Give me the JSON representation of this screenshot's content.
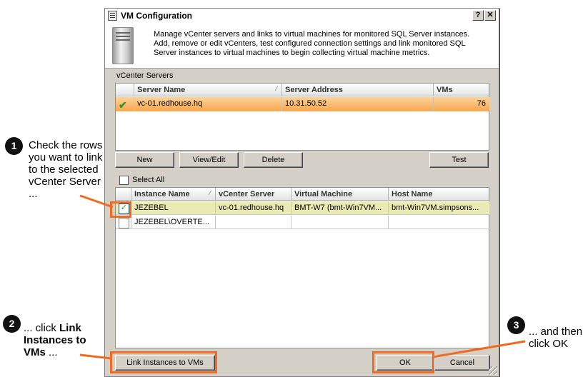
{
  "dialog": {
    "title": "VM Configuration",
    "help_button": "?",
    "close_button": "✕",
    "description": "Manage vCenter servers and links to virtual machines for monitored SQL Server instances. Add, remove or edit vCenters, test configured connection settings and link monitored SQL Server instances to virtual machines to begin collecting virtual machine metrics."
  },
  "vcenter": {
    "section_label": "vCenter Servers",
    "columns": [
      "Server Name",
      "Server Address",
      "VMs"
    ],
    "rows": [
      {
        "name": "vc-01.redhouse.hq",
        "address": "10.31.50.52",
        "vms": "76"
      }
    ],
    "buttons": {
      "new": "New",
      "view_edit": "View/Edit",
      "delete": "Delete",
      "test": "Test"
    }
  },
  "instances": {
    "select_all": "Select All",
    "columns": [
      "Instance Name",
      "vCenter Server",
      "Virtual Machine",
      "Host Name"
    ],
    "rows": [
      {
        "instance": "JEZEBEL",
        "vcenter": "vc-01.redhouse.hq",
        "vm": "BMT-W7  (bmt-Win7VM...",
        "host": "bmt-Win7VM.simpsons...",
        "checked": true
      },
      {
        "instance": "JEZEBEL\\OVERTE...",
        "vcenter": "",
        "vm": "",
        "host": "",
        "checked": false
      }
    ]
  },
  "footer": {
    "link_button": "Link Instances to VMs",
    "ok": "OK",
    "cancel": "Cancel"
  },
  "annotations": {
    "step1_num": "1",
    "step1_text": "Check the rows you want to link to the selected vCenter Server ...",
    "step2_num": "2",
    "step2_prefix": "... click ",
    "step2_bold": "Link Instances to VMs",
    "step2_suffix": " ...",
    "step3_num": "3",
    "step3_text": "... and then click OK"
  },
  "colors": {
    "accent": "#f06a20",
    "selected_row": "#f7a64d",
    "checked_row": "#e9eab4"
  }
}
